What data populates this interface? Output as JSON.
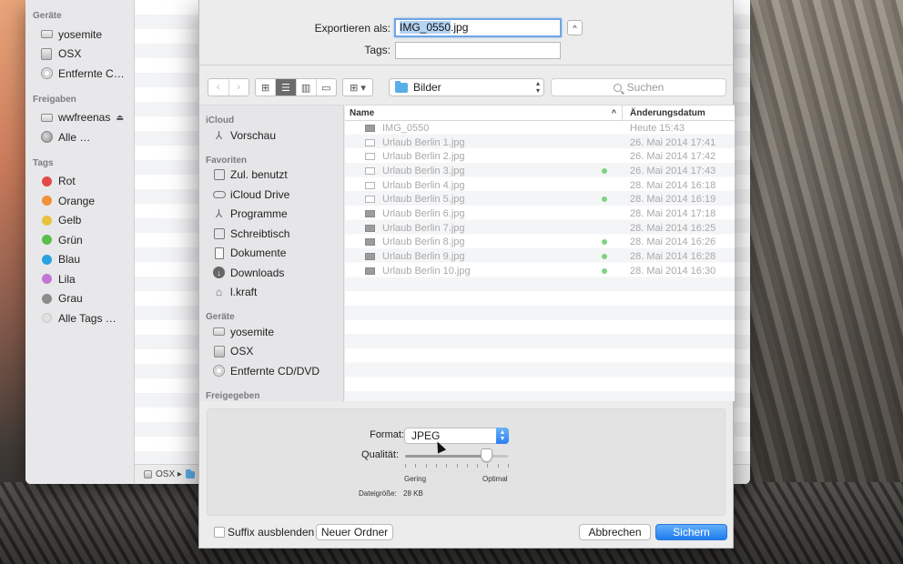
{
  "finder": {
    "sidebar": {
      "sections": [
        {
          "heading": "Geräte",
          "items": [
            {
              "label": "yosemite",
              "icon": "drive-icon"
            },
            {
              "label": "OSX",
              "icon": "disk-icon"
            },
            {
              "label": "Entfernte C…",
              "icon": "cd-icon"
            }
          ]
        },
        {
          "heading": "Freigaben",
          "items": [
            {
              "label": "wwfreenas",
              "icon": "server-icon",
              "eject": "⏏"
            },
            {
              "label": "Alle …",
              "icon": "network-icon"
            }
          ]
        }
      ],
      "tags_heading": "Tags",
      "tags": [
        {
          "label": "Rot",
          "color": "#e2474b"
        },
        {
          "label": "Orange",
          "color": "#f0913a"
        },
        {
          "label": "Gelb",
          "color": "#e9c23d"
        },
        {
          "label": "Grün",
          "color": "#5cbd4a"
        },
        {
          "label": "Blau",
          "color": "#2aa1e0"
        },
        {
          "label": "Lila",
          "color": "#c277d6"
        },
        {
          "label": "Grau",
          "color": "#8c8c8c"
        },
        {
          "label": "Alle Tags …",
          "color": "#e0e0e0"
        }
      ]
    },
    "status_path": "OSX ▸"
  },
  "dialog": {
    "export_label": "Exportieren als:",
    "filename_selected": "IMG_0550",
    "filename_ext": ".jpg",
    "tags_label": "Tags:",
    "tags_value": "",
    "expand_glyph": "^",
    "nav": {
      "back": "‹",
      "forward": "›"
    },
    "view_glyphs": [
      "⊞",
      "☰",
      "▥",
      "▭"
    ],
    "arrange_glyph": "⊞ ▾",
    "location": "Bilder",
    "search_placeholder": "Suchen",
    "sidebar": [
      {
        "heading": "iCloud",
        "items": [
          {
            "label": "Vorschau",
            "icon": "preview-icon"
          }
        ]
      },
      {
        "heading": "Favoriten",
        "items": [
          {
            "label": "Zul. benutzt",
            "icon": "recents-icon"
          },
          {
            "label": "iCloud Drive",
            "icon": "icloud-icon"
          },
          {
            "label": "Programme",
            "icon": "applications-icon"
          },
          {
            "label": "Schreibtisch",
            "icon": "desktop-icon"
          },
          {
            "label": "Dokumente",
            "icon": "documents-icon"
          },
          {
            "label": "Downloads",
            "icon": "downloads-icon"
          },
          {
            "label": "l.kraft",
            "icon": "home-icon"
          }
        ]
      },
      {
        "heading": "Geräte",
        "items": [
          {
            "label": "yosemite",
            "icon": "drive-icon"
          },
          {
            "label": "OSX",
            "icon": "disk-icon"
          },
          {
            "label": "Entfernte CD/DVD",
            "icon": "cd-icon"
          }
        ]
      },
      {
        "heading": "Freigegeben",
        "items": []
      }
    ],
    "columns": {
      "name": "Name",
      "date": "Änderungsdatum",
      "sort_glyph": "^"
    },
    "files": [
      {
        "name": "IMG_0550",
        "date": "Heute 15:43",
        "tag": false,
        "dark": true
      },
      {
        "name": "Urlaub Berlin 1.jpg",
        "date": "26. Mai 2014 17:41",
        "tag": false,
        "dark": false
      },
      {
        "name": "Urlaub Berlin 2.jpg",
        "date": "26. Mai 2014 17:42",
        "tag": false,
        "dark": false
      },
      {
        "name": "Urlaub Berlin 3.jpg",
        "date": "26. Mai 2014 17:43",
        "tag": true,
        "dark": false
      },
      {
        "name": "Urlaub Berlin 4.jpg",
        "date": "28. Mai 2014 16:18",
        "tag": false,
        "dark": false
      },
      {
        "name": "Urlaub Berlin 5.jpg",
        "date": "28. Mai 2014 16:19",
        "tag": true,
        "dark": false
      },
      {
        "name": "Urlaub Berlin 6.jpg",
        "date": "28. Mai 2014 17:18",
        "tag": false,
        "dark": true
      },
      {
        "name": "Urlaub Berlin 7.jpg",
        "date": "28. Mai 2014 16:25",
        "tag": false,
        "dark": true
      },
      {
        "name": "Urlaub Berlin 8.jpg",
        "date": "28. Mai 2014 16:26",
        "tag": true,
        "dark": true
      },
      {
        "name": "Urlaub Berlin 9.jpg",
        "date": "28. Mai 2014 16:28",
        "tag": true,
        "dark": true
      },
      {
        "name": "Urlaub Berlin 10.jpg",
        "date": "28. Mai 2014 16:30",
        "tag": true,
        "dark": true
      }
    ],
    "tag_color": "#7ed37e",
    "options": {
      "format_label": "Format:",
      "format_value": "JPEG",
      "quality_label": "Qualität:",
      "quality_fraction": 0.8,
      "quality_min_label": "Gering",
      "quality_max_label": "Optimal",
      "filesize_label": "Dateigröße:",
      "filesize_value": "28 KB"
    },
    "footer": {
      "hide_extension_label": "Suffix ausblenden",
      "hide_extension_checked": false,
      "new_folder_label": "Neuer Ordner",
      "cancel_label": "Abbrechen",
      "save_label": "Sichern"
    },
    "accent_color": "#2b7ef0"
  }
}
